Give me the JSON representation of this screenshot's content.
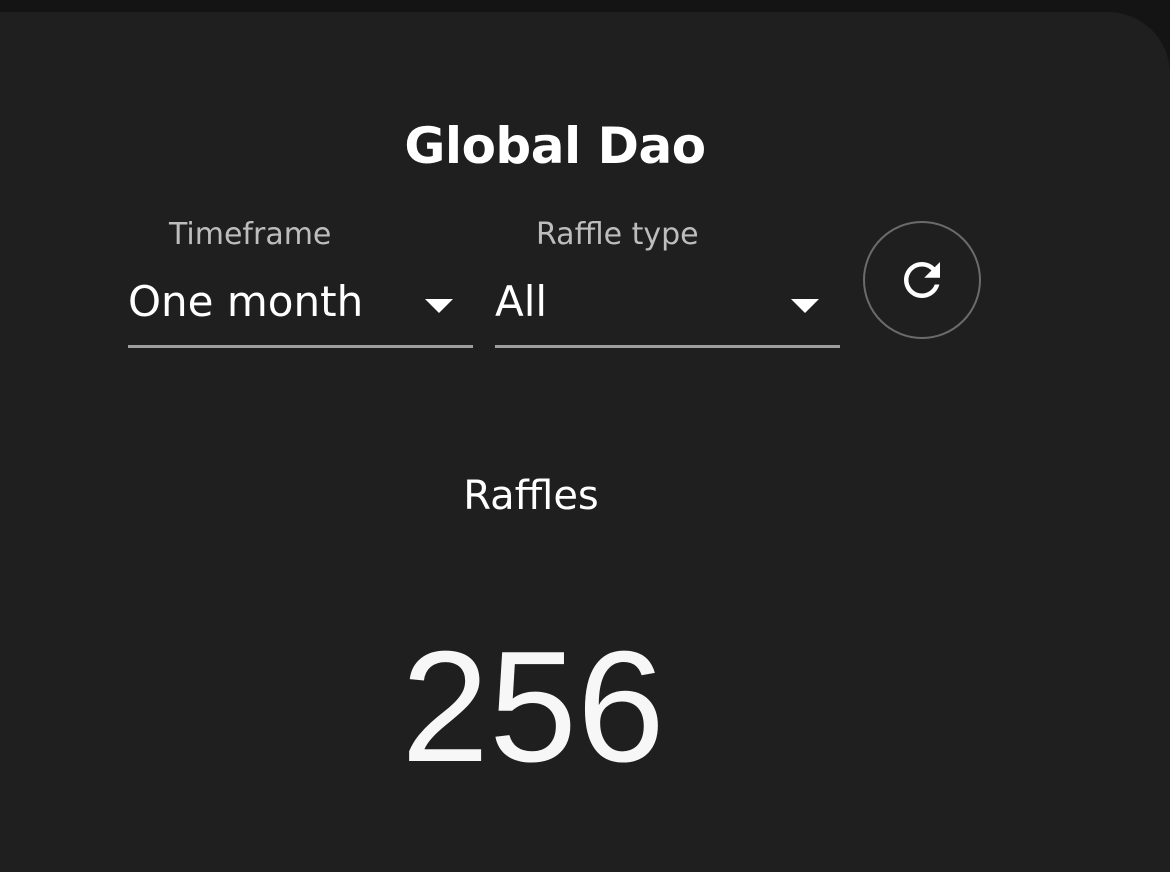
{
  "title": "Global Dao",
  "filters": {
    "timeframe": {
      "label": "Timeframe",
      "value": "One month"
    },
    "raffle_type": {
      "label": "Raffle type",
      "value": "All"
    }
  },
  "refresh": {
    "icon": "refresh-icon"
  },
  "stats": {
    "raffles_label": "Raffles",
    "raffles_value": "256"
  }
}
